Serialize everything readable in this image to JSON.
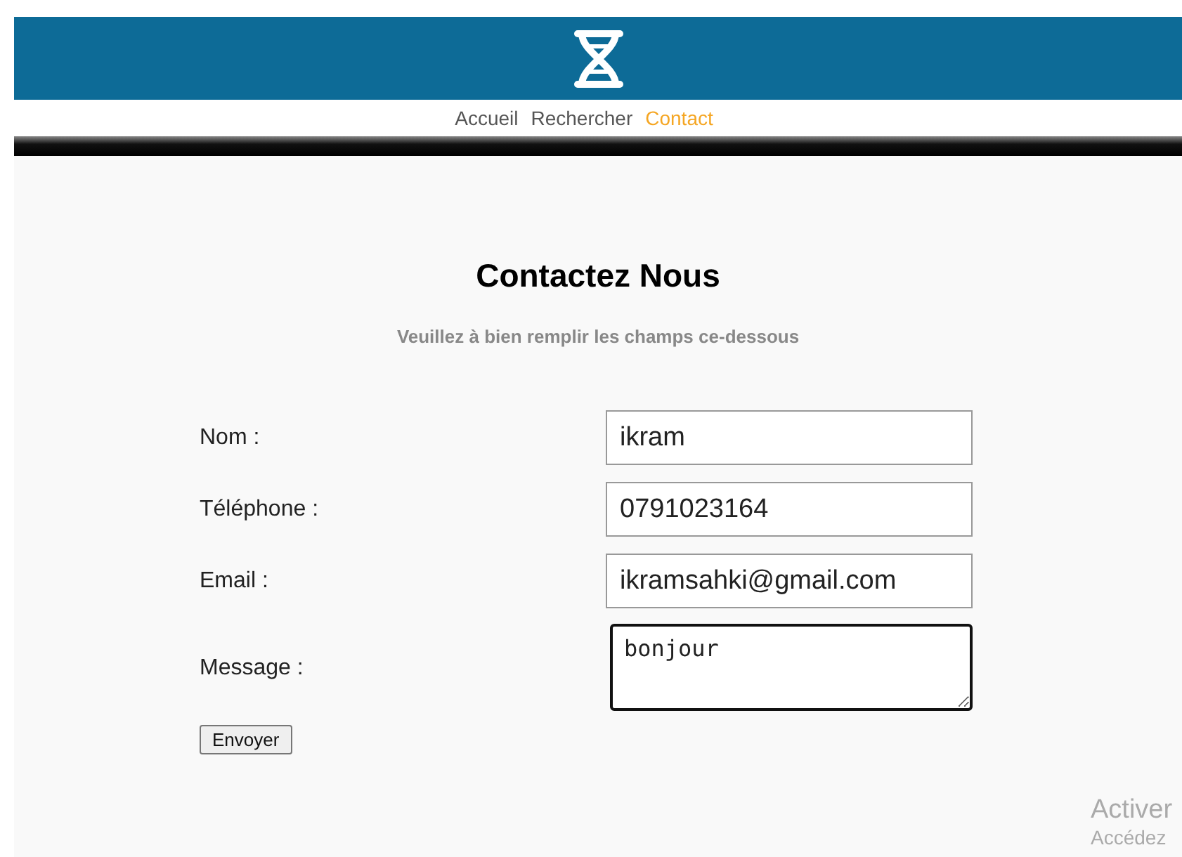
{
  "nav": [
    {
      "label": "Accueil",
      "selected": false
    },
    {
      "label": "Rechercher",
      "selected": false
    },
    {
      "label": "Contact",
      "selected": true
    }
  ],
  "heading": "Contactez Nous",
  "subtitle": "Veuillez à bien remplir les champs ce-dessous",
  "fields": [
    {
      "label": "Nom :",
      "kind": "input",
      "value": "ikram",
      "focused": false
    },
    {
      "label": "Téléphone :",
      "kind": "input",
      "value": "0791023164",
      "focused": false
    },
    {
      "label": "Email :",
      "kind": "input",
      "value": "ikramsahki@gmail.com",
      "focused": false
    },
    {
      "label": "Message :",
      "kind": "textarea",
      "value": "bonjour",
      "focused": true
    }
  ],
  "submit": "Envoyer",
  "activation_notice": {
    "title": "Activer",
    "text": "Accédez"
  }
}
